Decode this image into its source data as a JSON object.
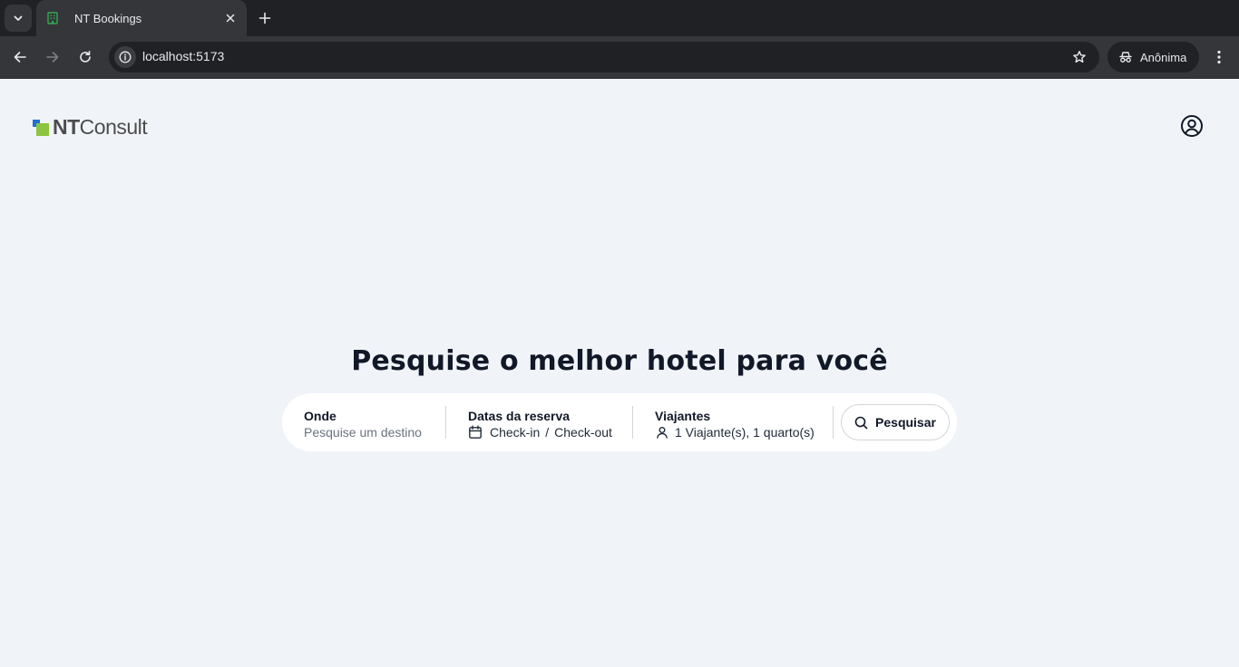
{
  "browser": {
    "tab_title": "NT Bookings",
    "url": "localhost:5173",
    "profile_label": "Anônima"
  },
  "header": {
    "logo_bold": "NT",
    "logo_light": "Consult"
  },
  "main": {
    "headline": "Pesquise o melhor hotel para você"
  },
  "search": {
    "where_label": "Onde",
    "where_placeholder": "Pesquise um destino",
    "dates_label": "Datas da reserva",
    "checkin": "Check-in",
    "date_separator": "/",
    "checkout": "Check-out",
    "travelers_label": "Viajantes",
    "travelers_value": "1 Viajante(s), 1 quarto(s)",
    "button_label": "Pesquisar"
  },
  "colors": {
    "page_bg": "#f0f4f9",
    "logo_blue": "#1e6fd9",
    "logo_green": "#8bc53f",
    "chrome_dark": "#202124",
    "chrome_toolbar": "#35363a"
  },
  "icons": [
    "tab-list-icon",
    "hotel-favicon-icon",
    "close-icon",
    "plus-icon",
    "back-arrow-icon",
    "forward-arrow-icon",
    "reload-icon",
    "site-info-icon",
    "star-icon",
    "incognito-icon",
    "more-vert-icon",
    "user-circle-icon",
    "calendar-icon",
    "person-icon",
    "search-icon"
  ]
}
